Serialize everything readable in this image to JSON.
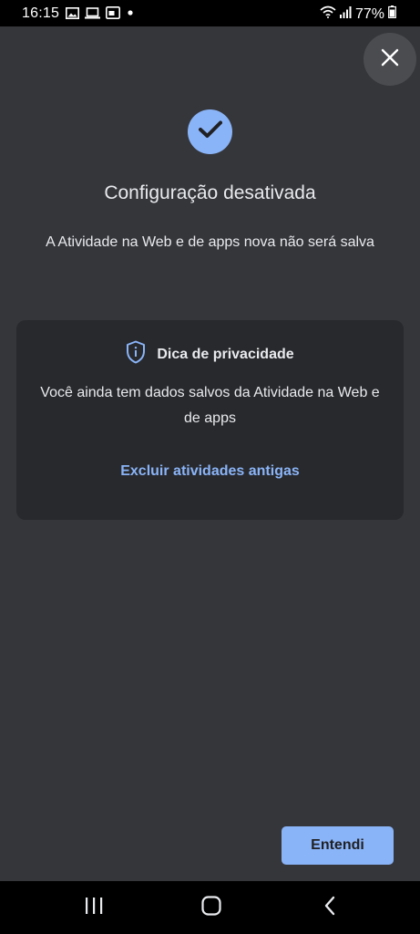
{
  "status_bar": {
    "time": "16:15",
    "battery": "77%",
    "icons": [
      "image-icon",
      "laptop-icon",
      "screencast-icon",
      "dot-icon",
      "wifi-icon",
      "signal-icon",
      "battery-icon"
    ]
  },
  "dialog": {
    "title": "Configuração desativada",
    "subtitle": "A Atividade na Web e de apps nova não será salva",
    "close_icon": "close-icon",
    "check_icon": "check-icon"
  },
  "tip": {
    "title": "Dica de privacidade",
    "body": "Você ainda tem dados salvos da Atividade na Web e de apps",
    "link": "Excluir atividades antigas",
    "icon": "shield-info-icon"
  },
  "actions": {
    "confirm_label": "Entendi"
  },
  "navigation": {
    "icons": [
      "recents-icon",
      "home-icon",
      "back-icon"
    ]
  },
  "colors": {
    "background": "#35363a",
    "card": "#28292c",
    "accent": "#8ab4f8",
    "text": "#e8eaed"
  }
}
